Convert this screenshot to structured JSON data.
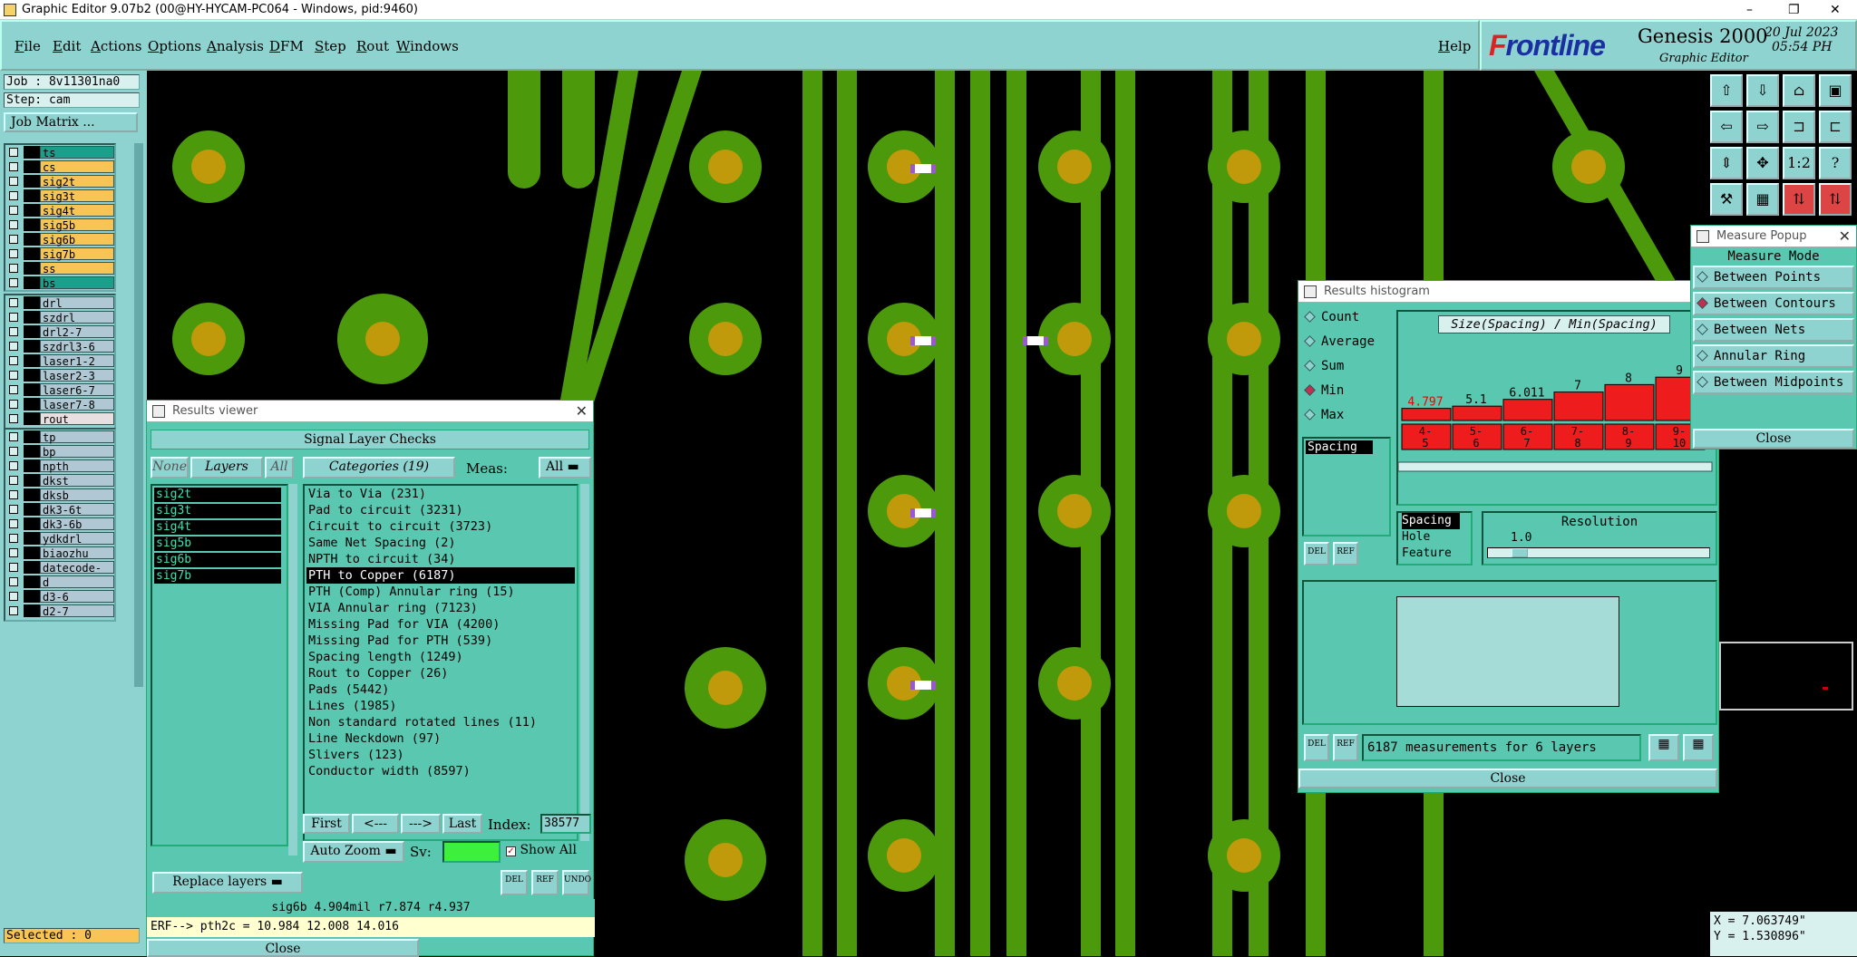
{
  "window": {
    "title": "Graphic Editor 9.07b2 (00@HY-HYCAM-PC064 - Windows, pid:9460)",
    "minimize": "–",
    "restore": "❐",
    "close": "✕"
  },
  "menu": [
    "File",
    "Edit",
    "Actions",
    "Options",
    "Analysis",
    "DFM",
    "Step",
    "Rout",
    "Windows"
  ],
  "help": "Help",
  "brand": {
    "logo_a": "F",
    "logo_b": "rontline",
    "product": "Genesis 2000",
    "subtitle": "Graphic Editor",
    "date": "20 Jul 2023",
    "time": "05:54 PH"
  },
  "job": {
    "job": "Job : 8v11301na0",
    "step": "Step: cam",
    "matrix_button": "Job Matrix ..."
  },
  "layers_board": [
    {
      "name": "ts",
      "color": "#1aa08a"
    },
    {
      "name": "cs",
      "color": "#f7c455"
    },
    {
      "name": "sig2t",
      "color": "#f7c455"
    },
    {
      "name": "sig3t",
      "color": "#f7c455"
    },
    {
      "name": "sig4t",
      "color": "#f7c455"
    },
    {
      "name": "sig5b",
      "color": "#f7c455"
    },
    {
      "name": "sig6b",
      "color": "#f7c455"
    },
    {
      "name": "sig7b",
      "color": "#f7c455"
    },
    {
      "name": "ss",
      "color": "#f7c455"
    },
    {
      "name": "bs",
      "color": "#1aa08a"
    }
  ],
  "layers_drill": [
    {
      "name": "drl",
      "color": "#b0c8d4"
    },
    {
      "name": "szdrl",
      "color": "#b0c8d4"
    },
    {
      "name": "drl2-7",
      "color": "#b0c8d4"
    },
    {
      "name": "szdrl3-6",
      "color": "#b0c8d4"
    },
    {
      "name": "laser1-2",
      "color": "#b0c8d4"
    },
    {
      "name": "laser2-3",
      "color": "#b0c8d4"
    },
    {
      "name": "laser6-7",
      "color": "#b0c8d4"
    },
    {
      "name": "laser7-8",
      "color": "#b0c8d4"
    },
    {
      "name": "rout",
      "color": "#e8e0e0"
    }
  ],
  "layers_misc": [
    {
      "name": "tp",
      "color": "#b0c8d4"
    },
    {
      "name": "bp",
      "color": "#b0c8d4"
    },
    {
      "name": "npth",
      "color": "#b0c8d4"
    },
    {
      "name": "dkst",
      "color": "#b0c8d4"
    },
    {
      "name": "dksb",
      "color": "#b0c8d4"
    },
    {
      "name": "dk3-6t",
      "color": "#b0c8d4"
    },
    {
      "name": "dk3-6b",
      "color": "#b0c8d4"
    },
    {
      "name": "ydkdrl",
      "color": "#b0c8d4"
    },
    {
      "name": "biaozhu",
      "color": "#b0c8d4"
    },
    {
      "name": "datecode-bs",
      "color": "#b0c8d4"
    },
    {
      "name": "d",
      "color": "#b0c8d4"
    },
    {
      "name": "d3-6",
      "color": "#b0c8d4"
    },
    {
      "name": "d2-7",
      "color": "#b0c8d4"
    }
  ],
  "selected": "Selected : 0",
  "results_viewer": {
    "title": "Results viewer",
    "header": "Signal Layer Checks",
    "none": "None",
    "layers": "Layers",
    "all": "All",
    "categories": "Categories (19)",
    "meas_label": "Meas:",
    "meas_value": "All",
    "layer_items": [
      "sig2t",
      "sig3t",
      "sig4t",
      "sig5b",
      "sig6b",
      "sig7b"
    ],
    "category_items": [
      "Via to Via (231)",
      "Pad to circuit (3231)",
      "Circuit to circuit (3723)",
      "Same Net Spacing (2)",
      "NPTH to circuit (34)",
      "PTH to Copper (6187)",
      "PTH (Comp) Annular ring (15)",
      "VIA Annular ring (7123)",
      "Missing Pad for VIA (4200)",
      "Missing Pad for PTH (539)",
      "Spacing length (1249)",
      "Rout to Copper (26)",
      "Pads (5442)",
      "Lines (1985)",
      "Non standard rotated lines (11)",
      "Line Neckdown (97)",
      "Slivers (123)",
      "Conductor width (8597)"
    ],
    "first": "First",
    "prev": "<---",
    "next": "--->",
    "last": "Last",
    "index_label": "Index:",
    "index_value": "38577",
    "auto_zoom": "Auto Zoom",
    "sv": "Sv:",
    "show_all": "Show All",
    "replace_layers": "Replace layers",
    "del": "DEL",
    "ref": "REF",
    "undo": "UNDO",
    "info": "sig6b 4.904mil  r7.874  r4.937",
    "erf": "ERF--> pth2c = 10.984 12.008 14.016",
    "close": "Close"
  },
  "histogram": {
    "title": "Results histogram",
    "modes": [
      "Count",
      "Average",
      "Sum",
      "Min",
      "Max"
    ],
    "selected_mode": "Min",
    "param_list": [
      "Spacing"
    ],
    "chart_title": "Size(Spacing) / Min(Spacing)",
    "bins": [
      "4-\n5",
      "5-\n6",
      "6-\n7",
      "7-\n8",
      "8-\n9",
      "9-\n10"
    ],
    "values": [
      "4.797",
      "5.1",
      "6.011",
      "7",
      "8",
      "9"
    ],
    "types": [
      "Spacing",
      "Hole",
      "Feature"
    ],
    "resolution_label": "Resolution",
    "resolution_value": "1.0",
    "status": "6187 measurements for 6 layers",
    "close": "Close",
    "del": "DEL",
    "ref": "REF"
  },
  "chart_data": {
    "type": "bar",
    "title": "Size(Spacing) / Min(Spacing)",
    "categories": [
      "4-5",
      "5-6",
      "6-7",
      "7-8",
      "8-9",
      "9-10"
    ],
    "values": [
      4.797,
      5.1,
      6.011,
      7,
      8,
      9
    ]
  },
  "measure": {
    "title": "Measure Popup",
    "mode_label": "Measure Mode",
    "options": [
      "Between Points",
      "Between Contours",
      "Between Nets",
      "Annular Ring",
      "Between Midpoints"
    ],
    "selected": "Between Contours",
    "close": "Close"
  },
  "coords": {
    "x": "X = 7.063749\"",
    "y": "Y = 1.530896\""
  }
}
